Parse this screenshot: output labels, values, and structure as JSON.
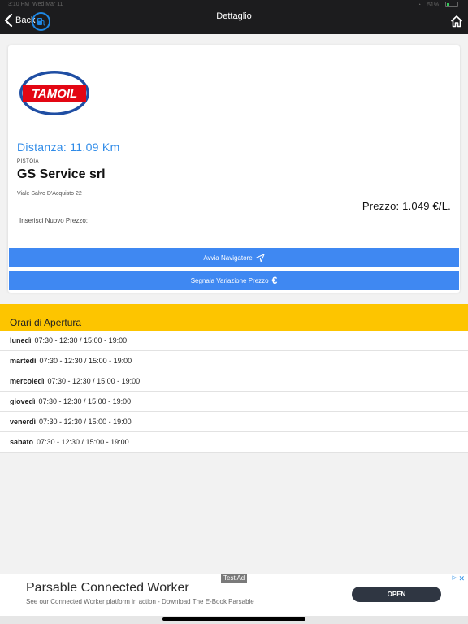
{
  "status_bar": {
    "time": "3:10 PM",
    "date": "Wed Mar 11",
    "battery": "51%"
  },
  "header": {
    "back_label": "Back",
    "title": "Dettaglio"
  },
  "station": {
    "brand": "TAMOIL",
    "distance": "Distanza: 11.09 Km",
    "city": "PISTOIA",
    "name": "GS Service srl",
    "address": "Viale Salvo D'Acquisto 22",
    "price": "Prezzo: 1.049 €/L.",
    "new_price_label": "Inserisci Nuovo Prezzo:"
  },
  "buttons": {
    "navigate": "Avvia Navigatore",
    "report": "Segnala Variazione Prezzo",
    "euro_symbol": "€"
  },
  "opening_hours": {
    "title": "Orari di Apertura",
    "rows": [
      {
        "day": "lunedì",
        "hours": "07:30 - 12:30 / 15:00 - 19:00"
      },
      {
        "day": "martedì",
        "hours": "07:30 - 12:30 / 15:00 - 19:00"
      },
      {
        "day": "mercoledì",
        "hours": "07:30 - 12:30 / 15:00 - 19:00"
      },
      {
        "day": "giovedì",
        "hours": "07:30 - 12:30 / 15:00 - 19:00"
      },
      {
        "day": "venerdì",
        "hours": "07:30 - 12:30 / 15:00 - 19:00"
      },
      {
        "day": "sabato",
        "hours": "07:30 - 12:30 / 15:00 - 19:00"
      }
    ]
  },
  "ad": {
    "badge": "Test Ad",
    "title": "Parsable Connected Worker",
    "description": "See our Connected Worker platform in action - Download The E-Book Parsable",
    "cta": "OPEN",
    "close": "✕"
  },
  "colors": {
    "accent_blue": "#3f88f2",
    "hours_header": "#fdc500",
    "nav_bar": "#1c1c1e",
    "brand_red": "#e30613"
  },
  "icons": [
    "back-chevron-icon",
    "fuel-pump-icon",
    "home-icon",
    "navigation-arrow-icon",
    "euro-icon",
    "ad-close-icon"
  ]
}
